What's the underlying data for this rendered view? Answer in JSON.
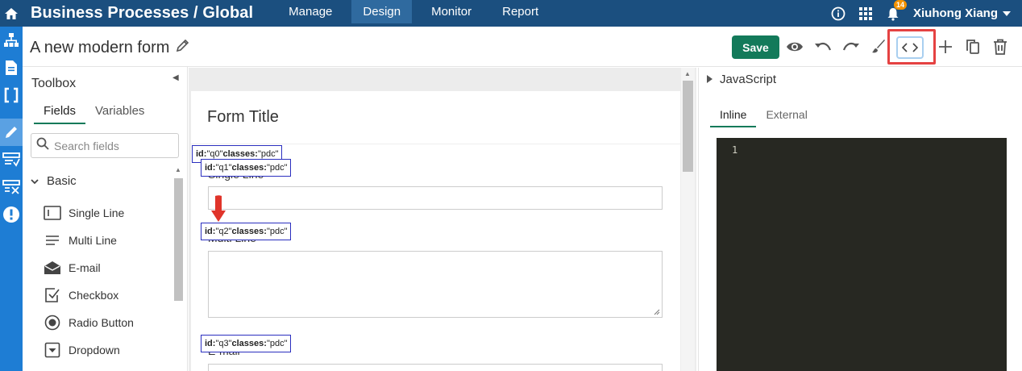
{
  "topbar": {
    "app_title": "Business Processes / Global",
    "nav": [
      {
        "label": "Manage",
        "active": false
      },
      {
        "label": "Design",
        "active": true
      },
      {
        "label": "Monitor",
        "active": false
      },
      {
        "label": "Report",
        "active": false
      }
    ],
    "notification_count": "14",
    "user_name": "Xiuhong Xiang",
    "icons": [
      "info-icon",
      "apps-grid-icon",
      "bell-icon",
      "chevron-down-icon"
    ]
  },
  "rail": {
    "icons": [
      "hierarchy-icon",
      "document-icon",
      "braces-icon",
      "pencil-icon",
      "form-checklist-icon",
      "form-grid-icon",
      "alert-icon"
    ],
    "active_index": 3
  },
  "form_header": {
    "form_name": "A new modern form",
    "save_label": "Save",
    "icons": [
      "preview-eye-icon",
      "undo-icon",
      "redo-icon",
      "brush-icon",
      "code-icon",
      "add-icon",
      "copy-icon",
      "trash-icon"
    ]
  },
  "toolbox": {
    "title": "Toolbox",
    "tabs": [
      "Fields",
      "Variables"
    ],
    "active_tab": "Fields",
    "search_placeholder": "Search fields",
    "section": "Basic",
    "fields": [
      {
        "label": "Single Line",
        "icon": "single-line-icon"
      },
      {
        "label": "Multi Line",
        "icon": "multi-line-icon"
      },
      {
        "label": "E-mail",
        "icon": "envelope-icon"
      },
      {
        "label": "Checkbox",
        "icon": "checkbox-icon"
      },
      {
        "label": "Radio Button",
        "icon": "radio-icon"
      },
      {
        "label": "Dropdown",
        "icon": "dropdown-icon"
      }
    ]
  },
  "canvas": {
    "form_title": "Form Title",
    "questions": [
      {
        "label": "Single Line"
      },
      {
        "label": "Multi Line"
      },
      {
        "label": "E-mail"
      }
    ],
    "tags": [
      {
        "id_label": "id:",
        "id": " \"q0\" ",
        "classes_label": "classes:",
        "classes": " \"pdc\""
      },
      {
        "id_label": "id:",
        "id": " \"q1\" ",
        "classes_label": "classes:",
        "classes": " \"pdc\""
      },
      {
        "id_label": "id:",
        "id": " \"q2\" ",
        "classes_label": "classes:",
        "classes": " \"pdc\""
      },
      {
        "id_label": "id:",
        "id": " \"q3\" ",
        "classes_label": "classes:",
        "classes": " \"pdc\""
      }
    ]
  },
  "js_panel": {
    "title": "JavaScript",
    "tabs": [
      "Inline",
      "External"
    ],
    "active_tab": "Inline",
    "line_number": "1"
  },
  "colors": {
    "topbar": "#1b4f7f",
    "rail": "#1e7dd4",
    "save": "#137a5a",
    "highlight": "#e54242",
    "editor": "#272822",
    "tag_border": "#2b2fbf"
  }
}
